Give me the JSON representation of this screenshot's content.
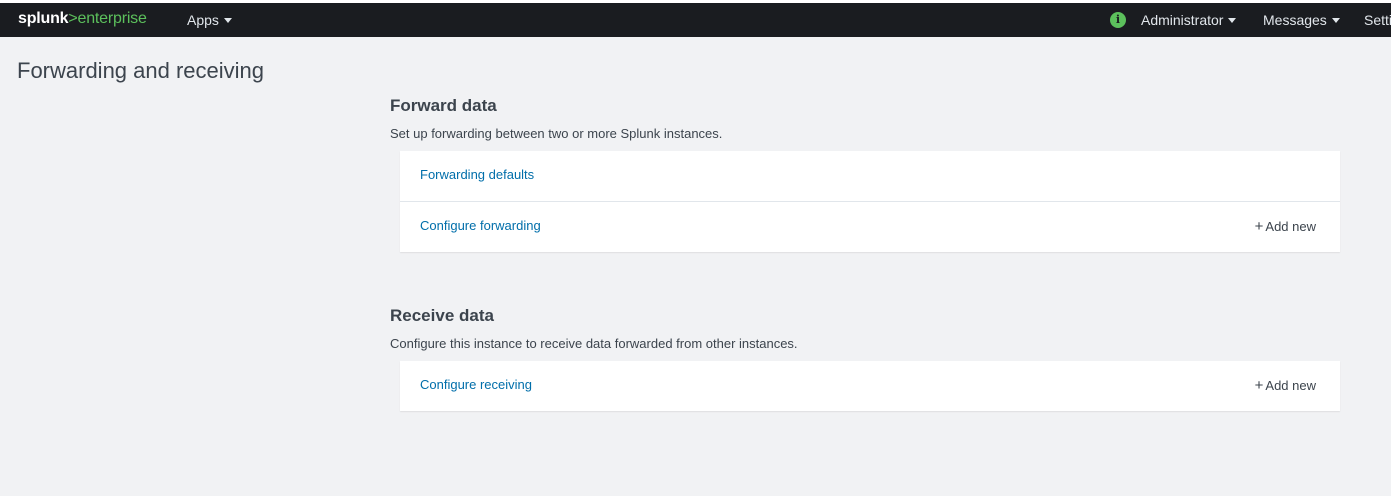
{
  "navbar": {
    "logo_splunk": "splunk",
    "logo_sep": ">",
    "logo_enterprise": "enterprise",
    "apps_label": "Apps",
    "info_icon_glyph": "i",
    "user_label": "Administrator",
    "messages_label": "Messages",
    "settings_label": "Setti"
  },
  "page": {
    "title": "Forwarding and receiving"
  },
  "forward": {
    "title": "Forward data",
    "description": "Set up forwarding between two or more Splunk instances.",
    "rows": [
      {
        "label": "Forwarding defaults",
        "add_label": ""
      },
      {
        "label": "Configure forwarding",
        "add_label": "Add new"
      }
    ]
  },
  "receive": {
    "title": "Receive data",
    "description": "Configure this instance to receive data forwarded from other instances.",
    "rows": [
      {
        "label": "Configure receiving",
        "add_label": "Add new"
      }
    ]
  },
  "colors": {
    "navbar_bg": "#1a1c20",
    "brand_green": "#5cc05c",
    "link_blue": "#006eaa",
    "page_bg": "#f1f2f4"
  },
  "icons": {
    "info": "info-icon",
    "caret": "caret-down-icon",
    "plus": "plus-icon"
  }
}
